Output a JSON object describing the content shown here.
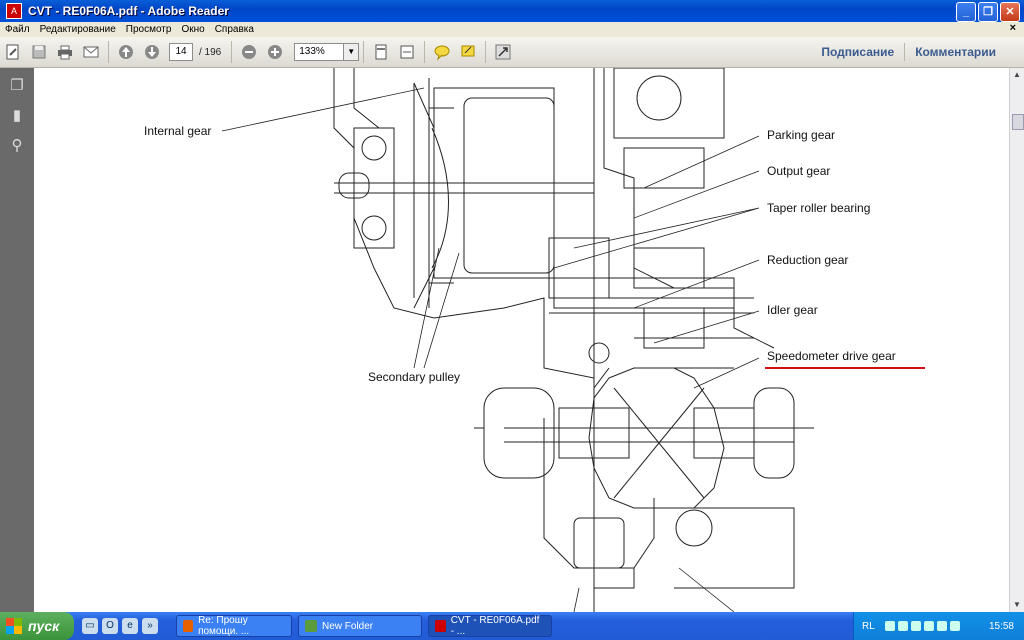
{
  "window": {
    "title": "CVT - RE0F06A.pdf - Adobe Reader"
  },
  "menu": {
    "items": [
      "Файл",
      "Редактирование",
      "Просмотр",
      "Окно",
      "Справка"
    ],
    "close": "×"
  },
  "toolbar": {
    "page_current": "14",
    "page_total": "/ 196",
    "zoom": "133%",
    "sign_label": "Подписание",
    "comments_label": "Комментарии"
  },
  "diagram": {
    "labels": {
      "internal_gear": "Internal gear",
      "parking_gear": "Parking gear",
      "output_gear": "Output gear",
      "taper_roller_bearing": "Taper roller bearing",
      "reduction_gear": "Reduction gear",
      "idler_gear": "Idler gear",
      "speedometer_drive_gear": "Speedometer drive gear",
      "secondary_pulley": "Secondary pulley"
    },
    "highlight_color": "#d01010"
  },
  "taskbar": {
    "start_label": "пуск",
    "tasks": [
      {
        "label": "Re: Прошу помощи. ..."
      },
      {
        "label": "New Folder"
      },
      {
        "label": "CVT - RE0F06A.pdf - ..."
      }
    ],
    "language": "RL",
    "clock": "15:58"
  }
}
